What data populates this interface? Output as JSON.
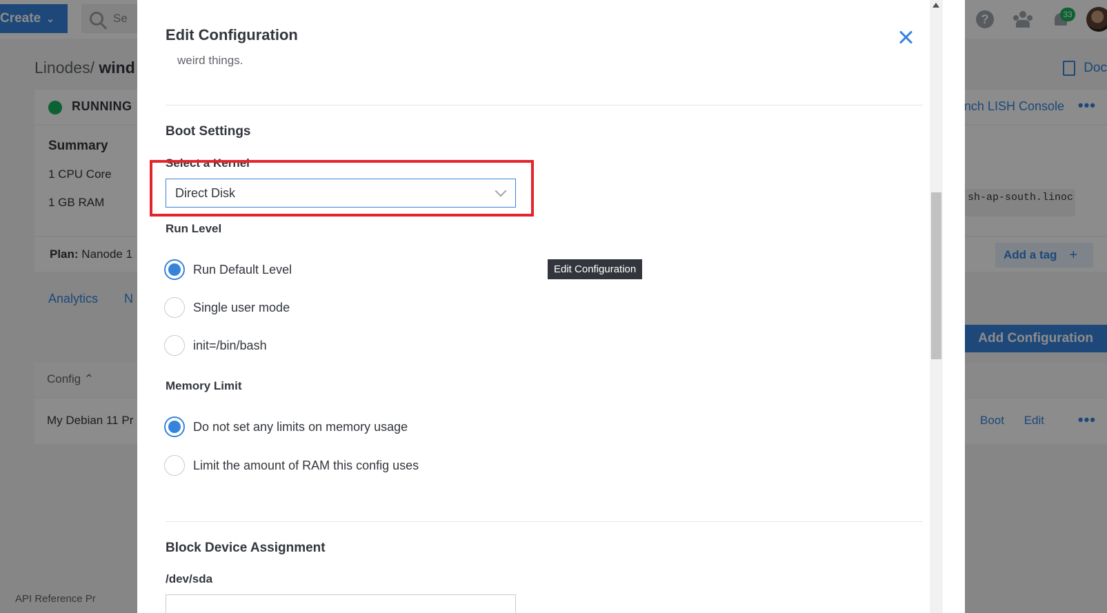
{
  "background": {
    "header": {
      "create_label": "Create",
      "search_placeholder": "Se",
      "notification_count": "33",
      "icons": [
        "search-icon",
        "help-icon",
        "community-icon",
        "bell-icon",
        "avatar"
      ]
    },
    "breadcrumb": {
      "parent": "Linodes",
      "separator": "/",
      "current": "wind"
    },
    "docs_label": "Doc",
    "status": {
      "text": "RUNNING",
      "lish_label": "Launch LISH Console",
      "dots": "•••",
      "color": "#17b25b"
    },
    "summary": {
      "title": "Summary",
      "cpu": "1 CPU Core",
      "ram": "1 GB RAM",
      "ssh_text": "sh-ap-south.linoc"
    },
    "plan": {
      "label": "Plan:",
      "value": "Nanode 1",
      "add_tag_label": "Add a tag",
      "add_tag_icon": "+"
    },
    "tabs": {
      "analytics": "Analytics",
      "second": "N"
    },
    "add_configuration_label": "Add Configuration",
    "config_table": {
      "header": "Config",
      "row_name": "My Debian 11 Pr",
      "boot_label": "Boot",
      "edit_label": "Edit",
      "dots": "•••"
    },
    "footer": "API Reference    Pr"
  },
  "drawer": {
    "title": "Edit Configuration",
    "helper_text": "weird things.",
    "boot_settings": {
      "title": "Boot Settings",
      "kernel_label": "Select a Kernel",
      "kernel_value": "Direct Disk",
      "run_level": {
        "label": "Run Level",
        "options": [
          {
            "label": "Run Default Level",
            "checked": true
          },
          {
            "label": "Single user mode",
            "checked": false
          },
          {
            "label": "init=/bin/bash",
            "checked": false
          }
        ]
      },
      "memory_limit": {
        "label": "Memory Limit",
        "options": [
          {
            "label": "Do not set any limits on memory usage",
            "checked": true
          },
          {
            "label": "Limit the amount of RAM this config uses",
            "checked": false
          }
        ]
      }
    },
    "tooltip": "Edit Configuration",
    "block_device": {
      "title": "Block Device Assignment",
      "sda_label": "/dev/sda"
    }
  },
  "colors": {
    "accent": "#3683dc",
    "highlight": "#e3242b",
    "status_green": "#17b25b"
  }
}
